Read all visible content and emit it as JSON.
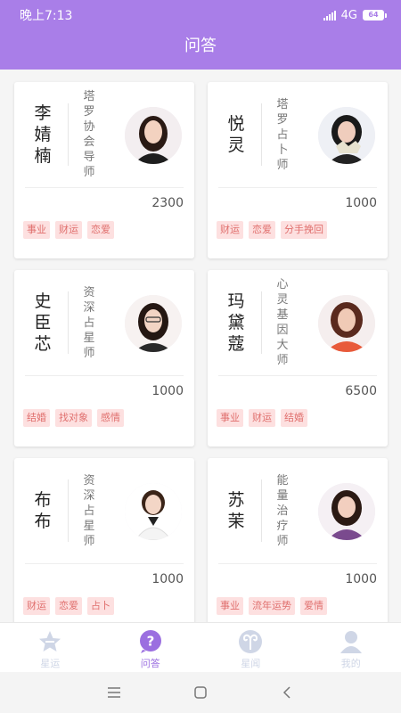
{
  "status_bar": {
    "time": "晚上7:13",
    "network": "4G",
    "battery": "64"
  },
  "header": {
    "title": "问答"
  },
  "cards": [
    {
      "name": [
        "李",
        "婧",
        "楠"
      ],
      "title": [
        "塔",
        "罗",
        "协",
        "会",
        "导",
        "师"
      ],
      "count": "2300",
      "tags": [
        "事业",
        "财运",
        "恋爱"
      ]
    },
    {
      "name": [
        "悦",
        "灵"
      ],
      "title": [
        "塔",
        "罗",
        "占",
        "卜",
        "师"
      ],
      "count": "1000",
      "tags": [
        "财运",
        "恋爱",
        "分手挽回"
      ]
    },
    {
      "name": [
        "史",
        "臣",
        "芯"
      ],
      "title": [
        "资",
        "深",
        "占",
        "星",
        "师"
      ],
      "count": "1000",
      "tags": [
        "结婚",
        "找对象",
        "感情"
      ]
    },
    {
      "name": [
        "玛",
        "黛",
        "蔻"
      ],
      "title": [
        "心",
        "灵",
        "基",
        "因",
        "大",
        "师"
      ],
      "count": "6500",
      "tags": [
        "事业",
        "财运",
        "结婚"
      ]
    },
    {
      "name": [
        "布",
        "布"
      ],
      "title": [
        "资",
        "深",
        "占",
        "星",
        "师"
      ],
      "count": "1000",
      "tags": [
        "财运",
        "恋爱",
        "占卜"
      ]
    },
    {
      "name": [
        "苏",
        "茉"
      ],
      "title": [
        "能",
        "量",
        "治",
        "疗",
        "师"
      ],
      "count": "1000",
      "tags": [
        "事业",
        "流年运势",
        "爱情"
      ]
    }
  ],
  "tabbar": {
    "items": [
      {
        "label": "星运",
        "icon": "star-icon",
        "active": false
      },
      {
        "label": "问答",
        "icon": "question-icon",
        "active": true
      },
      {
        "label": "星闻",
        "icon": "aries-icon",
        "active": false
      },
      {
        "label": "我的",
        "icon": "user-icon",
        "active": false
      }
    ]
  },
  "navbar": {
    "menu_icon": "menu-icon",
    "home_icon": "home-icon",
    "back_icon": "back-icon"
  },
  "colors": {
    "accent": "#a97ee8",
    "tag_text": "#e0706e",
    "tag_bg": "#fde0e0",
    "inactive_tab": "#cfd6e6"
  }
}
